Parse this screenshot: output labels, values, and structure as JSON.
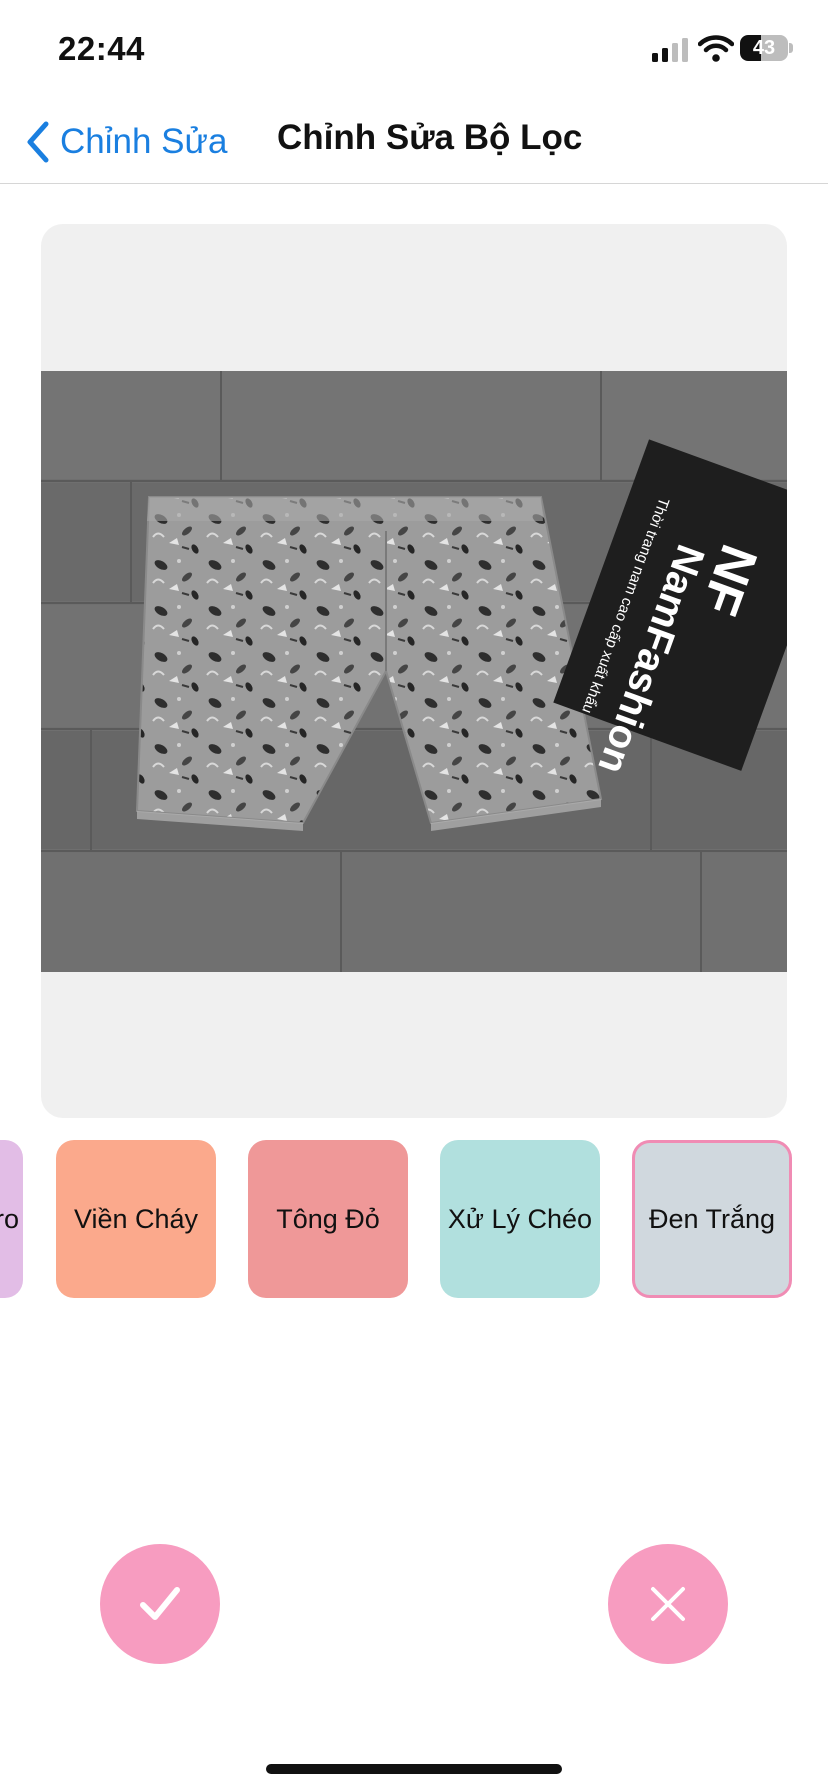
{
  "status_bar": {
    "time": "22:44",
    "battery_level": "43",
    "battery_fraction": 0.43
  },
  "nav": {
    "back_label": "Chỉnh Sửa",
    "title": "Chỉnh Sửa Bộ Lọc"
  },
  "preview": {
    "brand_name": "NamFashion",
    "brand_tagline": "Thời trang nam cao cấp xuất khẩu",
    "brand_logo": "NF"
  },
  "filters": [
    {
      "label": "ro",
      "color": "#e2bde6",
      "selected": false
    },
    {
      "label": "Viền Cháy",
      "color": "#fba98c",
      "selected": false
    },
    {
      "label": "Tông Đỏ",
      "color": "#ef9898",
      "selected": false
    },
    {
      "label": "Xử Lý Chéo",
      "color": "#b1e0de",
      "selected": false
    },
    {
      "label": "Đen Trắng",
      "color": "#d0d8de",
      "selected": true
    }
  ],
  "actions": {
    "confirm_icon": "checkmark-icon",
    "cancel_icon": "close-icon",
    "color": "#f79cc0"
  },
  "theme": {
    "accent": "#1a7fe0",
    "selected_border": "#f08cb4"
  }
}
